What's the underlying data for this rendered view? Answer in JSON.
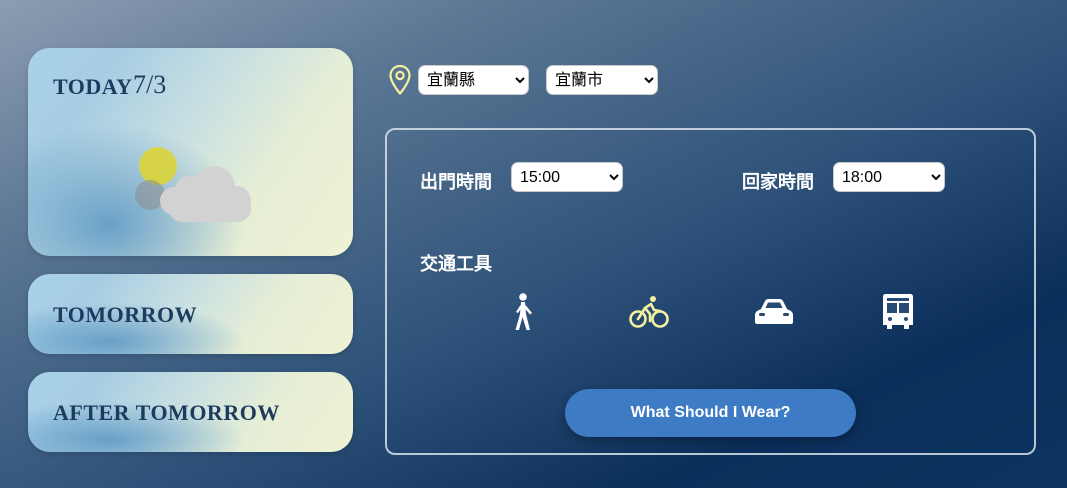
{
  "forecast": {
    "today_label": "TODAY",
    "today_date": "7/3",
    "today_weather_icon": "partly-cloudy-icon",
    "tomorrow_label": "TOMORROW",
    "after_tomorrow_label": "AFTER TOMORROW"
  },
  "location": {
    "pin_icon": "location-pin-icon",
    "county": "宜蘭縣",
    "city": "宜蘭市"
  },
  "schedule": {
    "depart_label": "出門時間",
    "depart_value": "15:00",
    "return_label": "回家時間",
    "return_value": "18:00"
  },
  "transport": {
    "label": "交通工具",
    "options": [
      {
        "icon": "walking-icon",
        "selected": false
      },
      {
        "icon": "bicycle-icon",
        "selected": true
      },
      {
        "icon": "car-icon",
        "selected": false
      },
      {
        "icon": "bus-icon",
        "selected": false
      }
    ]
  },
  "action": {
    "button_label": "What Should I Wear?"
  },
  "colors": {
    "accent_yellow": "#f3f0a2",
    "button_blue": "#3e7bc5",
    "title_navy": "#1d3b5e"
  }
}
